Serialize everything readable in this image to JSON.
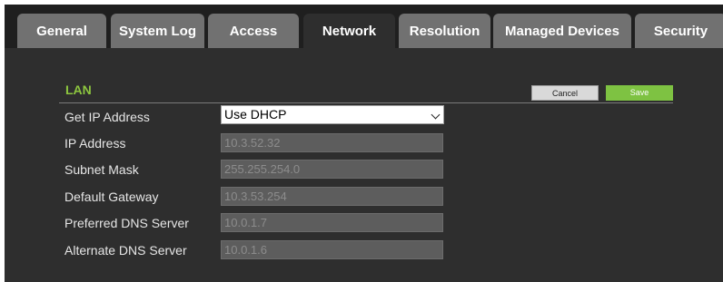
{
  "tabs": [
    {
      "label": "General"
    },
    {
      "label": "System Log"
    },
    {
      "label": "Access"
    },
    {
      "label": "Network"
    },
    {
      "label": "Resolution"
    },
    {
      "label": "Managed Devices"
    },
    {
      "label": "Security"
    }
  ],
  "active_tab": "Network",
  "section": {
    "title": "LAN"
  },
  "buttons": {
    "cancel": "Cancel",
    "save": "Save"
  },
  "form": {
    "get_ip": {
      "label": "Get IP Address",
      "value": "Use DHCP"
    },
    "ip_address": {
      "label": "IP Address",
      "value": "10.3.52.32"
    },
    "subnet_mask": {
      "label": "Subnet Mask",
      "value": "255.255.254.0"
    },
    "default_gateway": {
      "label": "Default Gateway",
      "value": "10.3.53.254"
    },
    "preferred_dns": {
      "label": "Preferred DNS Server",
      "value": "10.0.1.7"
    },
    "alternate_dns": {
      "label": "Alternate DNS Server",
      "value": "10.0.1.6"
    }
  },
  "colors": {
    "accent_green": "#8dc63f",
    "save_green": "#7ec242",
    "tab_inactive": "#717171",
    "panel": "#2e2e2e"
  }
}
